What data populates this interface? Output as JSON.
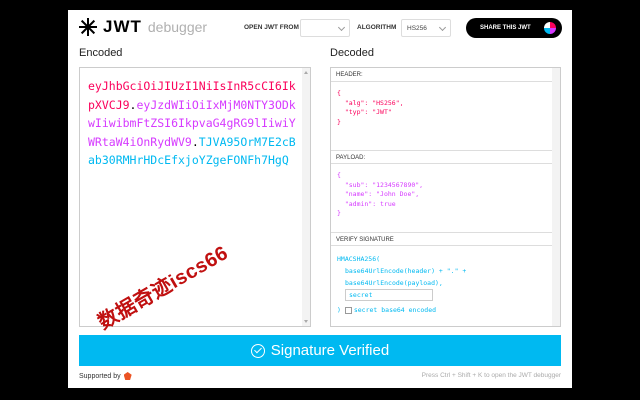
{
  "header": {
    "logo_jwt": "JWT",
    "logo_debugger": "debugger",
    "open_jwt_from_label": "OPEN JWT FROM",
    "open_jwt_from_value": "",
    "algorithm_label": "ALGORITHM",
    "algorithm_value": "HS256",
    "share_button": "SHARE THIS JWT"
  },
  "encoded": {
    "title": "Encoded",
    "header_part": "eyJhbGciOiJIUzI1NiIsInR5cCI6IkpXVCJ9",
    "payload_part": "eyJzdWIiOiIxMjM0NTY3ODkwIiwibmFtZSI6IkpvaG4gRG9lIiwiYWRtaW4iOnRydWV9",
    "signature_part": "TJVA95OrM7E2cBab30RMHrHDcEfxjoYZgeFONFh7HgQ"
  },
  "decoded": {
    "title": "Decoded",
    "header_label": "HEADER:",
    "header_lines": [
      "{",
      "  \"alg\": \"HS256\",",
      "  \"typ\": \"JWT\"",
      "}"
    ],
    "payload_label": "PAYLOAD:",
    "payload_lines": [
      "{",
      "  \"sub\": \"1234567890\",",
      "  \"name\": \"John Doe\",",
      "  \"admin\": true",
      "}"
    ],
    "signature_label": "VERIFY SIGNATURE",
    "sig_line1": "HMACSHA256(",
    "sig_line2": "base64UrlEncode(header) + \".\" +",
    "sig_line3": "base64UrlEncode(payload),",
    "secret_value": "secret",
    "sig_close": ")",
    "secret_b64_label": "secret base64 encoded"
  },
  "status": {
    "verified_label": "Signature Verified"
  },
  "footer": {
    "supported_by": "Supported by",
    "shortcut_hint": "Press Ctrl + Shift + K to open the JWT debugger"
  },
  "watermark": "数据奇迹iscs66",
  "colors": {
    "header_token": "#fb015b",
    "payload_token": "#d63aff",
    "signature_token": "#00b9f1",
    "verified_bar": "#00b9f1"
  }
}
